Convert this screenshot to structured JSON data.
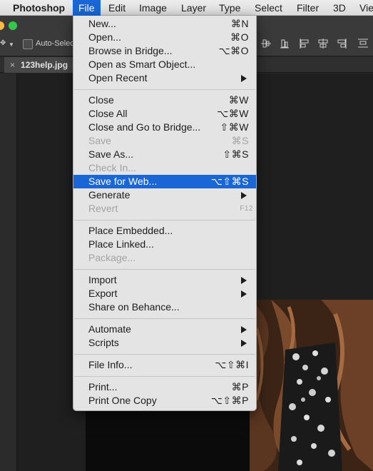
{
  "menubar": {
    "items": [
      "Photoshop",
      "File",
      "Edit",
      "Image",
      "Layer",
      "Type",
      "Select",
      "Filter",
      "3D",
      "Vie"
    ]
  },
  "optbar": {
    "auto_select_label": "Auto-Select"
  },
  "document_tab": {
    "close_glyph": "×",
    "title": "123help.jpg"
  },
  "file_menu": {
    "items": [
      {
        "label": "New...",
        "shortcut": "⌘N"
      },
      {
        "label": "Open...",
        "shortcut": "⌘O"
      },
      {
        "label": "Browse in Bridge...",
        "shortcut": "⌥⌘O"
      },
      {
        "label": "Open as Smart Object...",
        "shortcut": ""
      },
      {
        "label": "Open Recent",
        "shortcut": ""
      },
      {
        "label": "Close",
        "shortcut": "⌘W"
      },
      {
        "label": "Close All",
        "shortcut": "⌥⌘W"
      },
      {
        "label": "Close and Go to Bridge...",
        "shortcut": "⇧⌘W"
      },
      {
        "label": "Save",
        "shortcut": "⌘S"
      },
      {
        "label": "Save As...",
        "shortcut": "⇧⌘S"
      },
      {
        "label": "Check In...",
        "shortcut": ""
      },
      {
        "label": "Save for Web...",
        "shortcut": "⌥⇧⌘S"
      },
      {
        "label": "Generate",
        "shortcut": ""
      },
      {
        "label": "Revert",
        "shortcut": "F12"
      },
      {
        "label": "Place Embedded...",
        "shortcut": ""
      },
      {
        "label": "Place Linked...",
        "shortcut": ""
      },
      {
        "label": "Package...",
        "shortcut": ""
      },
      {
        "label": "Import",
        "shortcut": ""
      },
      {
        "label": "Export",
        "shortcut": ""
      },
      {
        "label": "Share on Behance...",
        "shortcut": ""
      },
      {
        "label": "Automate",
        "shortcut": ""
      },
      {
        "label": "Scripts",
        "shortcut": ""
      },
      {
        "label": "File Info...",
        "shortcut": "⌥⇧⌘I"
      },
      {
        "label": "Print...",
        "shortcut": "⌘P"
      },
      {
        "label": "Print One Copy",
        "shortcut": "⌥⇧⌘P"
      }
    ]
  },
  "colors": {
    "selection": "#1a66d6",
    "menu_bg": "#e4e4e4",
    "disabled_text": "#a3a3a3",
    "close_button": "#fc605c",
    "minimize_button": "#fdbc40",
    "zoom_button": "#34c84a"
  }
}
